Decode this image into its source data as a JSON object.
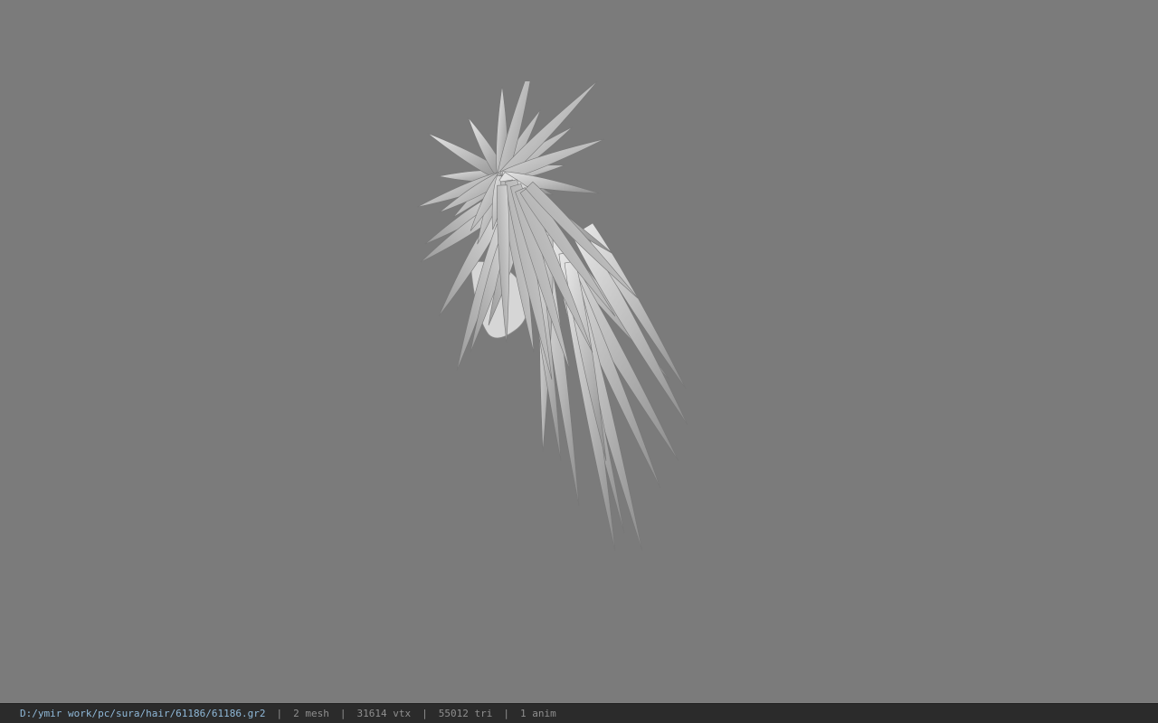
{
  "viewport": {
    "background": "#7b7b7b",
    "model_icon": "hair-mesh-icon"
  },
  "statusbar": {
    "file_path": "D:/ymir work/pc/sura/hair/61186/61186.gr2",
    "separator": "|",
    "mesh": "2 mesh",
    "vtx": "31614 vtx",
    "tri": "55012 tri",
    "anim": "1 anim"
  }
}
